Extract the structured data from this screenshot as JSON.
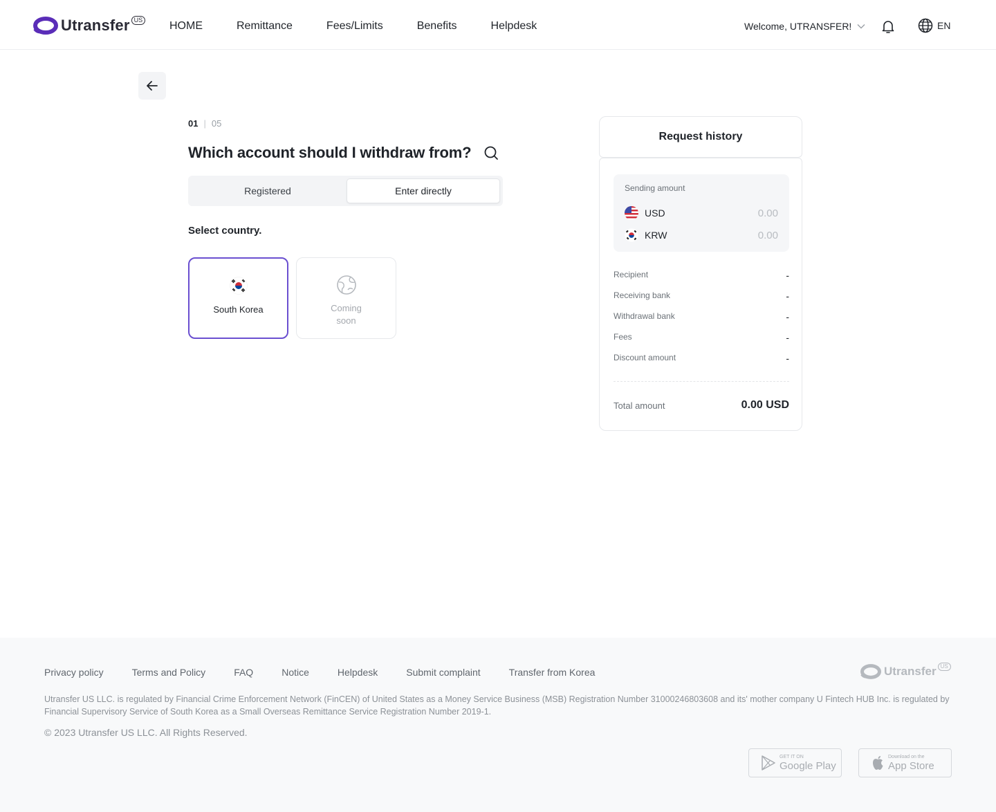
{
  "header": {
    "logo_text": "Utransfer",
    "logo_sup": "US",
    "nav": [
      "HOME",
      "Remittance",
      "Fees/Limits",
      "Benefits",
      "Helpdesk"
    ],
    "welcome": "Welcome, UTRANSFER!",
    "language": "EN"
  },
  "step": {
    "current": "01",
    "total": "05"
  },
  "main": {
    "title": "Which account should I withdraw from?",
    "tabs": {
      "registered": "Registered",
      "enter_directly": "Enter directly",
      "selected": "Enter directly"
    },
    "select_label": "Select country.",
    "countries": [
      {
        "label": "South Korea",
        "selected": true
      },
      {
        "label": "Coming soon",
        "selected": false
      }
    ]
  },
  "request_history": {
    "title": "Request history",
    "sending_amount_label": "Sending amount",
    "currencies": [
      {
        "code": "USD",
        "amount": "0.00"
      },
      {
        "code": "KRW",
        "amount": "0.00"
      }
    ],
    "rows": [
      {
        "label": "Recipient",
        "value": "-"
      },
      {
        "label": "Receiving bank",
        "value": "-"
      },
      {
        "label": "Withdrawal bank",
        "value": "-"
      },
      {
        "label": "Fees",
        "value": "-"
      },
      {
        "label": "Discount amount",
        "value": "-"
      }
    ],
    "total_label": "Total amount",
    "total_value": "0.00 USD"
  },
  "footer": {
    "links": [
      "Privacy policy",
      "Terms and Policy",
      "FAQ",
      "Notice",
      "Helpdesk",
      "Submit complaint",
      "Transfer from Korea"
    ],
    "logo_text": "Utransfer",
    "logo_sup": "US",
    "disclaimer": "Utransfer US LLC. is regulated by Financial Crime Enforcement Network (FinCEN) of United States as a Money Service Business (MSB) Registration Number 31000246803608 and its' mother company U Fintech HUB Inc. is regulated by Financial Supervisory Service of South Korea as a Small Overseas Remittance Service Registration Number 2019-1.",
    "copyright": "© 2023 Utransfer US LLC. All Rights Reserved.",
    "google_play": {
      "small": "GET IT ON",
      "big": "Google Play"
    },
    "app_store": {
      "small": "Download on the",
      "big": "App Store"
    }
  },
  "colors": {
    "brand": "#6a34c8",
    "selected_border": "#6a4fd0",
    "muted": "#b8bcc1"
  }
}
